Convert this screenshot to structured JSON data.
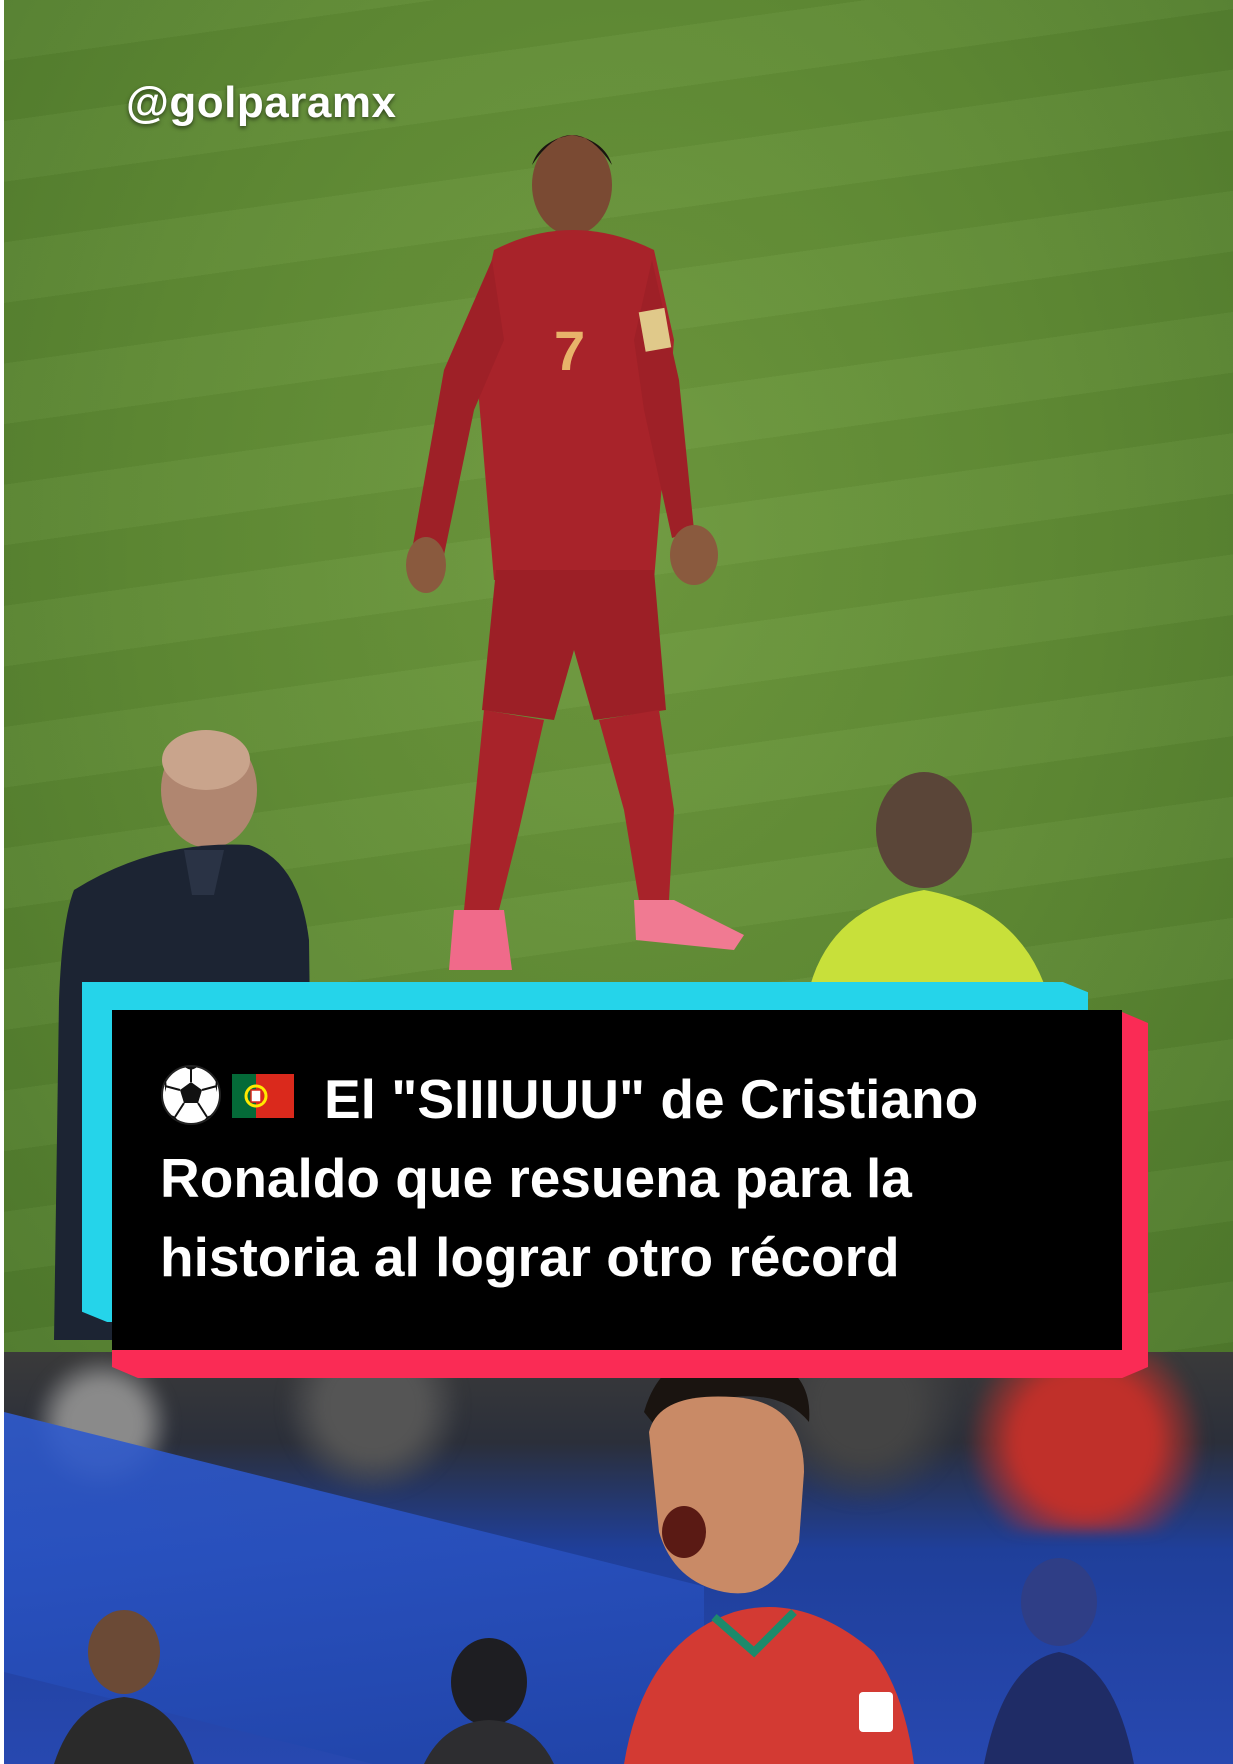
{
  "overlay": {
    "handle": "@golparamx",
    "caption_lines": [
      "El \"SIIIUUU\" de Cristiano",
      "Ronaldo que resuena para la",
      "historia al lograr otro récord"
    ],
    "caption_icons": [
      "soccer-ball-icon",
      "portugal-flag-icon"
    ]
  },
  "player": {
    "shirt_number": "7"
  },
  "colors": {
    "pitch_green": "#5f8a34",
    "kit_red": "#a8232a",
    "referee_yellow": "#c8e03a",
    "card_black": "#000000",
    "accent_cyan": "#25d4ea",
    "accent_red": "#fa2b55",
    "stadium_blue": "#2748b0"
  }
}
